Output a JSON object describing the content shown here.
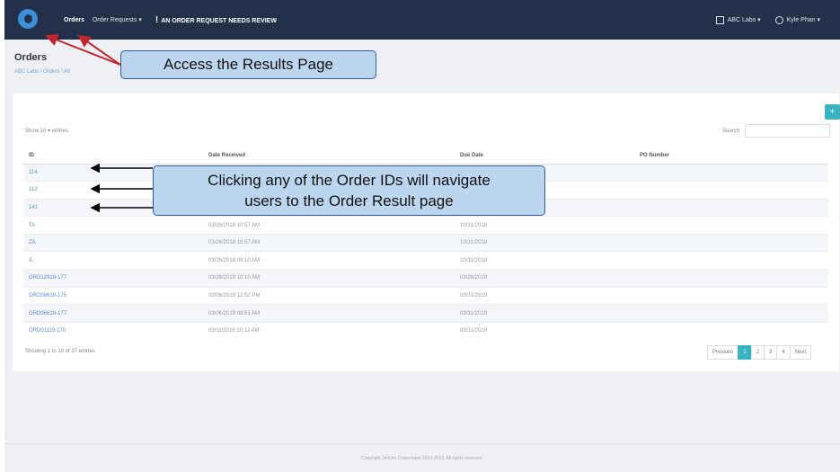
{
  "topbar": {
    "nav": [
      {
        "label": "Orders"
      },
      {
        "label": "Order Requests ▾"
      }
    ],
    "alert": "AN ORDER REQUEST NEEDS REVIEW",
    "lab": "ABC Labs ▾",
    "user": "Kyle Phan ▾"
  },
  "page": {
    "title": "Orders",
    "breadcrumb": "ABC Labs / Orders / All"
  },
  "annotations": {
    "top": "Access the Results Page",
    "middle_line1": "Clicking any of the Order IDs will navigate",
    "middle_line2": "users to the Order Result page"
  },
  "table": {
    "show_entries": "Show 10 ▾ entries",
    "search_label": "Search:",
    "add_button": "+",
    "headers": [
      "ID",
      "Date Received",
      "Due Date",
      "PO Number"
    ],
    "rows": [
      {
        "id": "114",
        "received": "",
        "due": "",
        "po": ""
      },
      {
        "id": "112",
        "received": "",
        "due": "",
        "po": ""
      },
      {
        "id": "141",
        "received": "",
        "due": "",
        "po": ""
      },
      {
        "id": "TA",
        "received": "03/26/2018 10:57 AM",
        "due": "10/31/2018",
        "po": ""
      },
      {
        "id": "ZA",
        "received": "03/26/2018 10:57 AM",
        "due": "10/31/2018",
        "po": ""
      },
      {
        "id": "A",
        "received": "03/26/2018 09:10 AM",
        "due": "10/31/2018",
        "po": ""
      },
      {
        "id": "ORD12819-177",
        "received": "03/28/2019 10:10 AM",
        "due": "03/28/2019",
        "po": ""
      },
      {
        "id": "ORD09619-175",
        "received": "03/06/2019 12:52 PM",
        "due": "03/31/2019",
        "po": ""
      },
      {
        "id": "ORD06619-177",
        "received": "03/06/2019 08:51 AM",
        "due": "03/31/2019",
        "po": ""
      },
      {
        "id": "ORD01119-170",
        "received": "03/11/2019 10:12 AM",
        "due": "03/31/2019",
        "po": ""
      }
    ],
    "footer_text": "Showing 1 to 10 of 37 entries",
    "pager": [
      "Previous",
      "1",
      "2",
      "3",
      "4",
      "Next"
    ]
  },
  "footer": "Copyright Jericho Corporation 2014-2019. All rights reserved."
}
